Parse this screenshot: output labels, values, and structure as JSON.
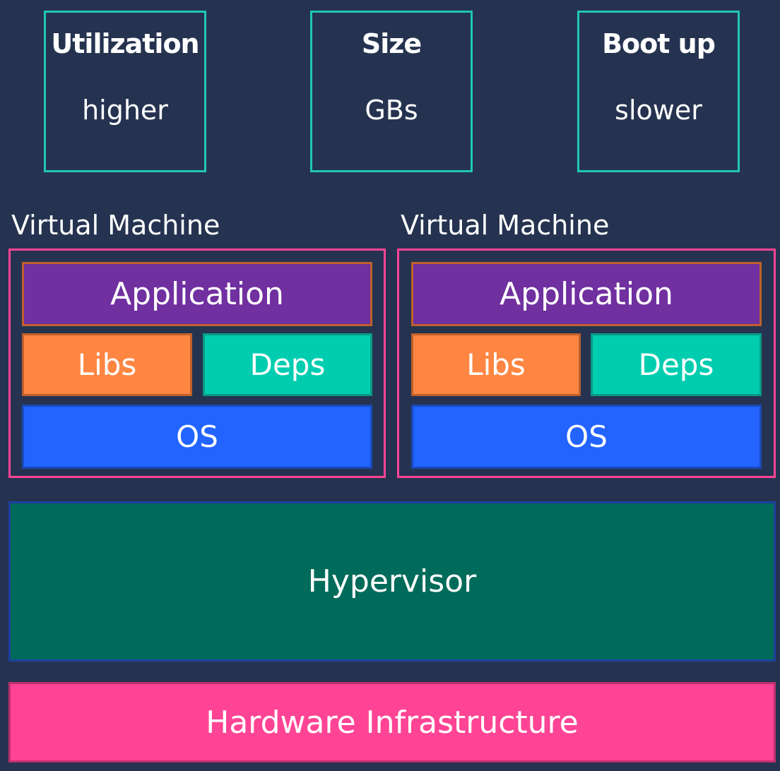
{
  "metrics": [
    {
      "title": "Utilization",
      "value": "higher"
    },
    {
      "title": "Size",
      "value": "GBs"
    },
    {
      "title": "Boot up",
      "value": "slower"
    }
  ],
  "vms": [
    {
      "label": "Virtual Machine",
      "application": "Application",
      "libs": "Libs",
      "deps": "Deps",
      "os": "OS"
    },
    {
      "label": "Virtual Machine",
      "application": "Application",
      "libs": "Libs",
      "deps": "Deps",
      "os": "OS"
    }
  ],
  "hypervisor": "Hypervisor",
  "hardware": "Hardware Infrastructure",
  "colors": {
    "background": "#253350",
    "metric_border": "#1fc8b0",
    "vm_border": "#ff4495",
    "application": "#7030a0",
    "libs": "#ff8642",
    "deps": "#00cdb0",
    "os": "#2364ff",
    "hypervisor": "#006b5a",
    "hardware": "#ff4495"
  }
}
